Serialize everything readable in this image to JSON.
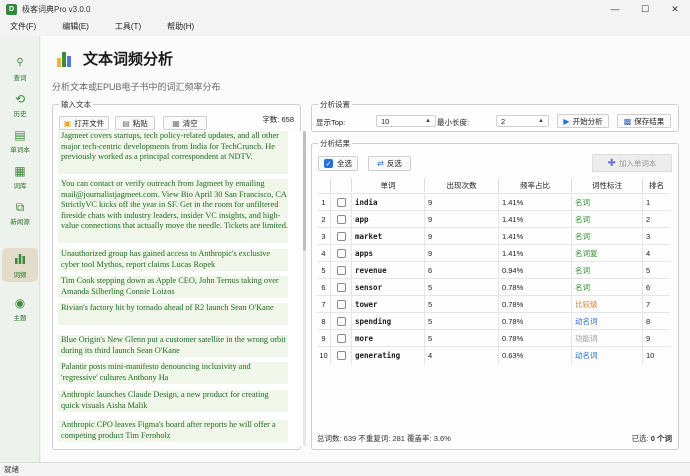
{
  "window": {
    "title": "极客词典Pro v3.0.0",
    "app_icon_letter": "D",
    "minimize": "—",
    "maximize": "☐",
    "close": "✕"
  },
  "menu": [
    "文件(F)",
    "编辑(E)",
    "工具(T)",
    "帮助(H)"
  ],
  "sidebar": [
    {
      "label": "查词",
      "icon": "search-icon",
      "glyph": "🔍"
    },
    {
      "label": "历史",
      "icon": "history-icon",
      "glyph": "⟲"
    },
    {
      "label": "单词本",
      "icon": "notebook-icon",
      "glyph": "▤"
    },
    {
      "label": "词库",
      "icon": "library-icon",
      "glyph": "▦"
    },
    {
      "label": "新闻源",
      "icon": "news-icon",
      "glyph": "⧉"
    },
    {
      "label": "词频",
      "icon": "frequency-icon",
      "glyph": "▮",
      "active": true
    },
    {
      "label": "主题",
      "icon": "palette-icon",
      "glyph": "◉"
    }
  ],
  "page": {
    "title": "文本词频分析",
    "subtitle": "分析文本或EPUB电子书中的词汇频率分布"
  },
  "input": {
    "group_title": "输入文本",
    "open_file": "打开文件",
    "paste": "粘贴",
    "clear": "清空",
    "word_count": "字数: 658",
    "paragraphs": [
      "Jagmeet covers startups, tech policy-related updates, and all other major tech-centric developments from India for TechCrunch. He previously worked as a principal correspondent at NDTV.",
      "You can contact or verify outreach from Jagmeet by emailing mail@journalistjagmeet.com. View Bio April 30 San Francisco, CA StrictlyVC kicks off the year in SF. Get in the room for unfiltered fireside chats with industry leaders, insider VC insights, and high-value connections that actually move the needle. Tickets are limited.",
      "Unauthorized group has gained access to Anthropic's exclusive cyber tool Mythos, report claims Lucas Ropek",
      "Tim Cook stepping down as Apple CEO, John Ternus taking over Amanda Silberling Connie Loizos",
      "Rivian's factory hit by tornado ahead of R2 launch Sean O'Kane",
      "Blue Origin's New Glenn put a customer satellite in the wrong orbit during its third launch Sean O'Kane",
      "Palantir posts mini-manifesto denouncing inclusivity and 'regressive' cultures Anthony Ha",
      "Anthropic launches Claude Design, a new product for creating quick visuals Aisha Malik",
      "Anthropic CPO leaves Figma's board after reports he will offer a competing product Tim Fernholz"
    ]
  },
  "settings": {
    "group_title": "分析设置",
    "top_label": "显示Top:",
    "top_value": "10",
    "min_len_label": "最小长度:",
    "min_len_value": "2",
    "start_button": "开始分析",
    "save_button": "保存结果"
  },
  "results": {
    "group_title": "分析结果",
    "select_all": "全选",
    "invert": "反选",
    "add_to_notebook": "加入单词本",
    "columns": [
      "",
      "",
      "单词",
      "出现次数",
      "频率占比",
      "词性标注",
      "排名"
    ],
    "rows": [
      {
        "n": "1",
        "word": "india",
        "count": "9",
        "pct": "1.41%",
        "pos": "名词",
        "pos_color": "#2e8b2e",
        "rank": "1"
      },
      {
        "n": "2",
        "word": "app",
        "count": "9",
        "pct": "1.41%",
        "pos": "名词",
        "pos_color": "#2e8b2e",
        "rank": "2"
      },
      {
        "n": "3",
        "word": "market",
        "count": "9",
        "pct": "1.41%",
        "pos": "名词",
        "pos_color": "#2e8b2e",
        "rank": "3"
      },
      {
        "n": "4",
        "word": "apps",
        "count": "9",
        "pct": "1.41%",
        "pos": "名词复",
        "pos_color": "#2e8b2e",
        "rank": "4"
      },
      {
        "n": "5",
        "word": "revenue",
        "count": "6",
        "pct": "0.94%",
        "pos": "名词",
        "pos_color": "#2e8b2e",
        "rank": "5"
      },
      {
        "n": "6",
        "word": "sensor",
        "count": "5",
        "pct": "0.78%",
        "pos": "名词",
        "pos_color": "#2e8b2e",
        "rank": "6"
      },
      {
        "n": "7",
        "word": "tower",
        "count": "5",
        "pct": "0.78%",
        "pos": "比较级",
        "pos_color": "#d9822b",
        "rank": "7"
      },
      {
        "n": "8",
        "word": "spending",
        "count": "5",
        "pct": "0.78%",
        "pos": "动名词",
        "pos_color": "#2b6fd6",
        "rank": "8"
      },
      {
        "n": "9",
        "word": "more",
        "count": "5",
        "pct": "0.78%",
        "pos": "功能词",
        "pos_color": "#999999",
        "rank": "9"
      },
      {
        "n": "10",
        "word": "generating",
        "count": "4",
        "pct": "0.63%",
        "pos": "动名词",
        "pos_color": "#2b6fd6",
        "rank": "10"
      }
    ],
    "stats": "总词数: 639  不重复词: 281  覆盖率: 3.6%",
    "selected_prefix": "已选: ",
    "selected_count": "0 个词"
  },
  "status": "就绪"
}
